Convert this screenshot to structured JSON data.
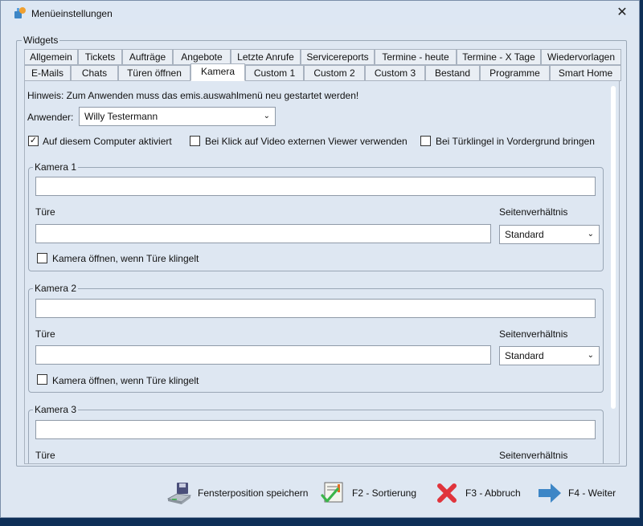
{
  "window": {
    "title": "Menüeinstellungen"
  },
  "group_label": "Widgets",
  "tabs_row1": [
    "Allgemein",
    "Tickets",
    "Aufträge",
    "Angebote",
    "Letzte Anrufe",
    "Servicereports",
    "Termine - heute",
    "Termine - X Tage",
    "Wiedervorlagen"
  ],
  "tabs_row2": [
    "E-Mails",
    "Chats",
    "Türen öffnen",
    "Kamera",
    "Custom 1",
    "Custom 2",
    "Custom 3",
    "Bestand",
    "Programme",
    "Smart Home"
  ],
  "active_tab": "Kamera",
  "hint": "Hinweis: Zum Anwenden muss das emis.auswahlmenü neu gestartet werden!",
  "user": {
    "label": "Anwender:",
    "value": "Willy Testermann"
  },
  "options": {
    "activate": {
      "label": "Auf diesem Computer aktiviert",
      "checked": true
    },
    "external_viewer": {
      "label": "Bei Klick auf Video externen Viewer verwenden",
      "checked": false
    },
    "bell_foreground": {
      "label": "Bei Türklingel in Vordergrund bringen",
      "checked": false
    }
  },
  "cameras": [
    {
      "title": "Kamera 1",
      "door_label": "Türe",
      "ratio_label": "Seitenverhältnis",
      "ratio_value": "Standard",
      "open_label": "Kamera öffnen, wenn Türe klingelt"
    },
    {
      "title": "Kamera 2",
      "door_label": "Türe",
      "ratio_label": "Seitenverhältnis",
      "ratio_value": "Standard",
      "open_label": "Kamera öffnen, wenn Türe klingelt"
    },
    {
      "title": "Kamera 3",
      "door_label": "Türe",
      "ratio_label": "Seitenverhältnis"
    }
  ],
  "footer": {
    "save": "Fensterposition speichern",
    "sort": "F2 - Sortierung",
    "cancel": "F3 - Abbruch",
    "next": "F4 - Weiter"
  },
  "colors": {
    "accent": "#1e6fc8",
    "check_green": "#3bb54a",
    "cancel_red": "#e0343c",
    "arrow_blue": "#3d86c6"
  }
}
